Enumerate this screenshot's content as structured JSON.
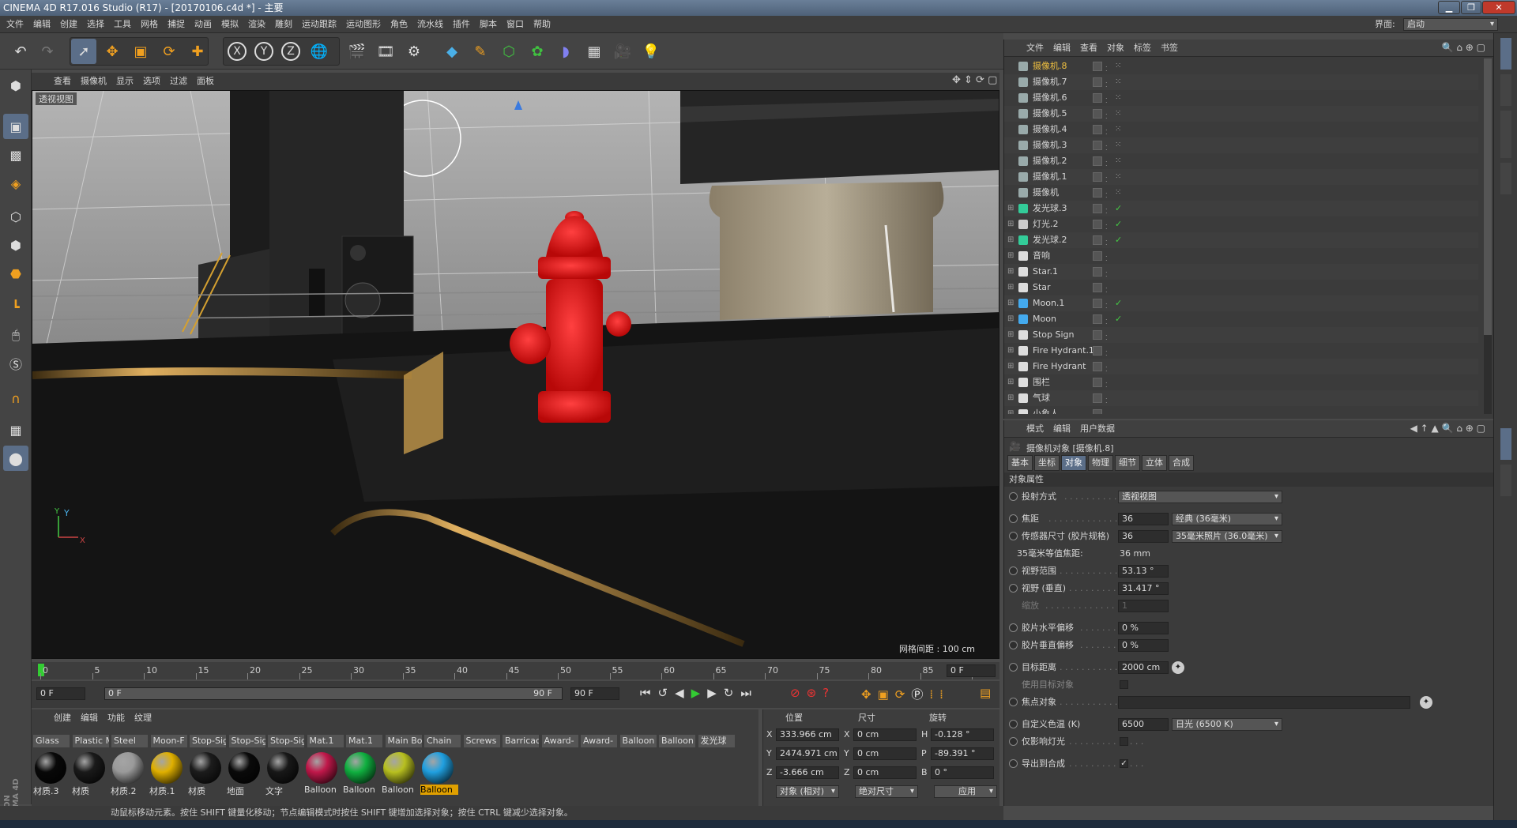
{
  "titlebar": {
    "title": "CINEMA 4D R17.016 Studio (R17) - [20170106.c4d *] - 主要"
  },
  "menubar": {
    "items": [
      "文件",
      "编辑",
      "创建",
      "选择",
      "工具",
      "网格",
      "捕捉",
      "动画",
      "模拟",
      "渲染",
      "雕刻",
      "运动跟踪",
      "运动图形",
      "角色",
      "流水线",
      "插件",
      "脚本",
      "窗口",
      "帮助"
    ],
    "layout_label": "界面:",
    "layout_value": "启动"
  },
  "viewport": {
    "menu": [
      "查看",
      "摄像机",
      "显示",
      "选项",
      "过滤",
      "面板"
    ],
    "view_name": "透视视图",
    "grid_spacing": "网格间距 : 100 cm",
    "axis_y": "Y",
    "axis_x": "X"
  },
  "timeline": {
    "ticks": [
      "0",
      "5",
      "10",
      "15",
      "20",
      "25",
      "30",
      "35",
      "40",
      "45",
      "50",
      "55",
      "60",
      "65",
      "70",
      "75",
      "80",
      "85",
      "90"
    ],
    "current_frame": "0 F",
    "start_field": "0 F",
    "range_start": "0 F",
    "range_end": "90 F",
    "end_field": "90 F"
  },
  "materials": {
    "menu": [
      "创建",
      "编辑",
      "功能",
      "纹理"
    ],
    "tabs": [
      "Glass",
      "Plastic M",
      "Steel",
      "Moon-F",
      "Stop-Sig",
      "Stop-Sig",
      "Stop-Sig",
      "Mat.1",
      "Mat.1",
      "Main Bo",
      "Chain",
      "Screws",
      "Barricad",
      "Award-",
      "Award-",
      "Balloon",
      "Balloon",
      "发光球"
    ],
    "items": [
      {
        "name": "材质.3",
        "color": "#080808"
      },
      {
        "name": "材质",
        "color": "#1a1a1a"
      },
      {
        "name": "材质.2",
        "color": "#9a9a9a"
      },
      {
        "name": "材质.1",
        "color": "#e0b000"
      },
      {
        "name": "材质",
        "color": "#1c1c1c"
      },
      {
        "name": "地面",
        "color": "#0a0a0a"
      },
      {
        "name": "文字",
        "color": "#181818"
      },
      {
        "name": "Balloon",
        "color": "#c0184a"
      },
      {
        "name": "Balloon",
        "color": "#10b040"
      },
      {
        "name": "Balloon",
        "color": "#b8c020"
      },
      {
        "name": "Balloon",
        "color": "#20a0e0"
      }
    ]
  },
  "coords": {
    "headers": [
      "位置",
      "尺寸",
      "旋转"
    ],
    "pos": [
      {
        "axis": "X",
        "value": "333.966 cm"
      },
      {
        "axis": "Y",
        "value": "2474.971 cm"
      },
      {
        "axis": "Z",
        "value": "-3.666 cm"
      }
    ],
    "size": [
      {
        "axis": "X",
        "value": "0 cm"
      },
      {
        "axis": "Y",
        "value": "0 cm"
      },
      {
        "axis": "Z",
        "value": "0 cm"
      }
    ],
    "rot": [
      {
        "axis": "H",
        "value": "-0.128 °"
      },
      {
        "axis": "P",
        "value": "-89.391 °"
      },
      {
        "axis": "B",
        "value": "0 °"
      }
    ],
    "mode": "对象 (相对)",
    "size_mode": "绝对尺寸",
    "apply": "应用"
  },
  "status": {
    "text": "动鼠标移动元素。按住 SHIFT 键量化移动；节点编辑模式时按住 SHIFT 键增加选择对象；按住 CTRL 键减少选择对象。"
  },
  "objects": {
    "menu": [
      "文件",
      "编辑",
      "查看",
      "对象",
      "标签",
      "书签"
    ],
    "rows": [
      {
        "name": "摄像机.8",
        "type": "camera",
        "selected": true
      },
      {
        "name": "摄像机.7",
        "type": "camera"
      },
      {
        "name": "摄像机.6",
        "type": "camera"
      },
      {
        "name": "摄像机.5",
        "type": "camera"
      },
      {
        "name": "摄像机.4",
        "type": "camera"
      },
      {
        "name": "摄像机.3",
        "type": "camera"
      },
      {
        "name": "摄像机.2",
        "type": "camera"
      },
      {
        "name": "摄像机.1",
        "type": "camera"
      },
      {
        "name": "摄像机",
        "type": "camera"
      },
      {
        "name": "发光球.3",
        "type": "sphere"
      },
      {
        "name": "灯光.2",
        "type": "light"
      },
      {
        "name": "发光球.2",
        "type": "sphere"
      },
      {
        "name": "音响",
        "type": "null"
      },
      {
        "name": "Star.1",
        "type": "null"
      },
      {
        "name": "Star",
        "type": "null"
      },
      {
        "name": "Moon.1",
        "type": "moon"
      },
      {
        "name": "Moon",
        "type": "moon"
      },
      {
        "name": "Stop Sign",
        "type": "null"
      },
      {
        "name": "Fire Hydrant.1",
        "type": "null"
      },
      {
        "name": "Fire Hydrant",
        "type": "null"
      },
      {
        "name": "围栏",
        "type": "null"
      },
      {
        "name": "气球",
        "type": "null"
      },
      {
        "name": "小象人",
        "type": "null"
      }
    ]
  },
  "attributes": {
    "menu": [
      "模式",
      "编辑",
      "用户数据"
    ],
    "object_title": "摄像机对象 [摄像机.8]",
    "tabs": [
      "基本",
      "坐标",
      "对象",
      "物理",
      "细节",
      "立体",
      "合成"
    ],
    "active_tab": "对象",
    "section": "对象属性",
    "projection_label": "投射方式",
    "projection_value": "透视视图",
    "focal_label": "焦距",
    "focal_value": "36",
    "focal_preset": "经典 (36毫米)",
    "sensor_label": "传感器尺寸 (胶片规格)",
    "sensor_value": "36",
    "sensor_preset": "35毫米照片 (36.0毫米)",
    "equiv_label": "35毫米等值焦距:",
    "equiv_value": "36 mm",
    "fov_label": "视野范围",
    "fov_value": "53.13 °",
    "fov_v_label": "视野 (垂直)",
    "fov_v_value": "31.417 °",
    "zoom_label": "缩放",
    "zoom_value": "1",
    "film_h_label": "胶片水平偏移",
    "film_h_value": "0 %",
    "film_v_label": "胶片垂直偏移",
    "film_v_value": "0 %",
    "target_dist_label": "目标距离",
    "target_dist_value": "2000 cm",
    "use_target_label": "使用目标对象",
    "focus_obj_label": "焦点对象",
    "white_balance_label": "自定义色温 (K)",
    "white_balance_value": "6500",
    "white_balance_preset": "日光 (6500 K)",
    "affect_lights_label": "仅影响灯光",
    "export_label": "导出到合成"
  },
  "colors": {
    "accent": "#5b6e88",
    "selected_text": "#f0c040",
    "check": "#44cc44"
  }
}
